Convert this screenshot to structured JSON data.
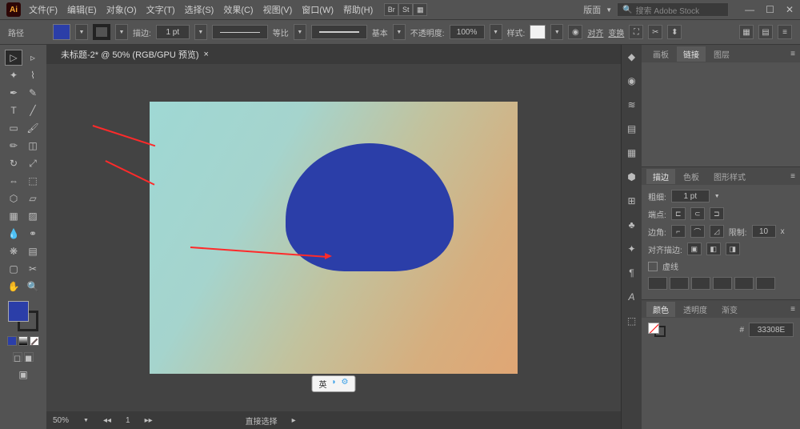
{
  "menu": {
    "file": "文件(F)",
    "edit": "编辑(E)",
    "object": "对象(O)",
    "type": "文字(T)",
    "select": "选择(S)",
    "effect": "效果(C)",
    "view": "视图(V)",
    "window": "窗口(W)",
    "help": "帮助(H)"
  },
  "badges": {
    "br": "Br",
    "st": "St"
  },
  "layout_label": "版面",
  "search_placeholder": "搜索 Adobe Stock",
  "options": {
    "path_label": "路径",
    "stroke_label": "描边:",
    "pt": "1 pt",
    "ratio": "等比",
    "basic": "基本",
    "opacity_label": "不透明度:",
    "opacity": "100%",
    "style_label": "样式:",
    "align_label": "对齐",
    "transform_label": "变换"
  },
  "tab": {
    "title": "未标题-2* @ 50% (RGB/GPU 预览)",
    "close": "×"
  },
  "status": {
    "zoom": "50%",
    "page": "1",
    "tool": "直接选择"
  },
  "lang_pill": {
    "lang": "英",
    "moon": "◗",
    "gear": "⚙"
  },
  "panels": {
    "top_tabs": {
      "artboard": "画板",
      "links": "链接",
      "layers": "图层"
    },
    "stroke_tabs": {
      "stroke": "描边",
      "swatches": "色板",
      "graphic_styles": "图形样式"
    },
    "weight_label": "粗细:",
    "weight": "1 pt",
    "cap_label": "端点:",
    "corner_label": "边角:",
    "limit_label": "限制:",
    "limit": "10",
    "limit_x": "x",
    "align_label": "对齐描边:",
    "dash_label": "虚线",
    "color_tabs": {
      "color": "颜色",
      "transparency": "透明度",
      "gradient": "渐变"
    },
    "hex": "33308E",
    "hash": "#"
  }
}
